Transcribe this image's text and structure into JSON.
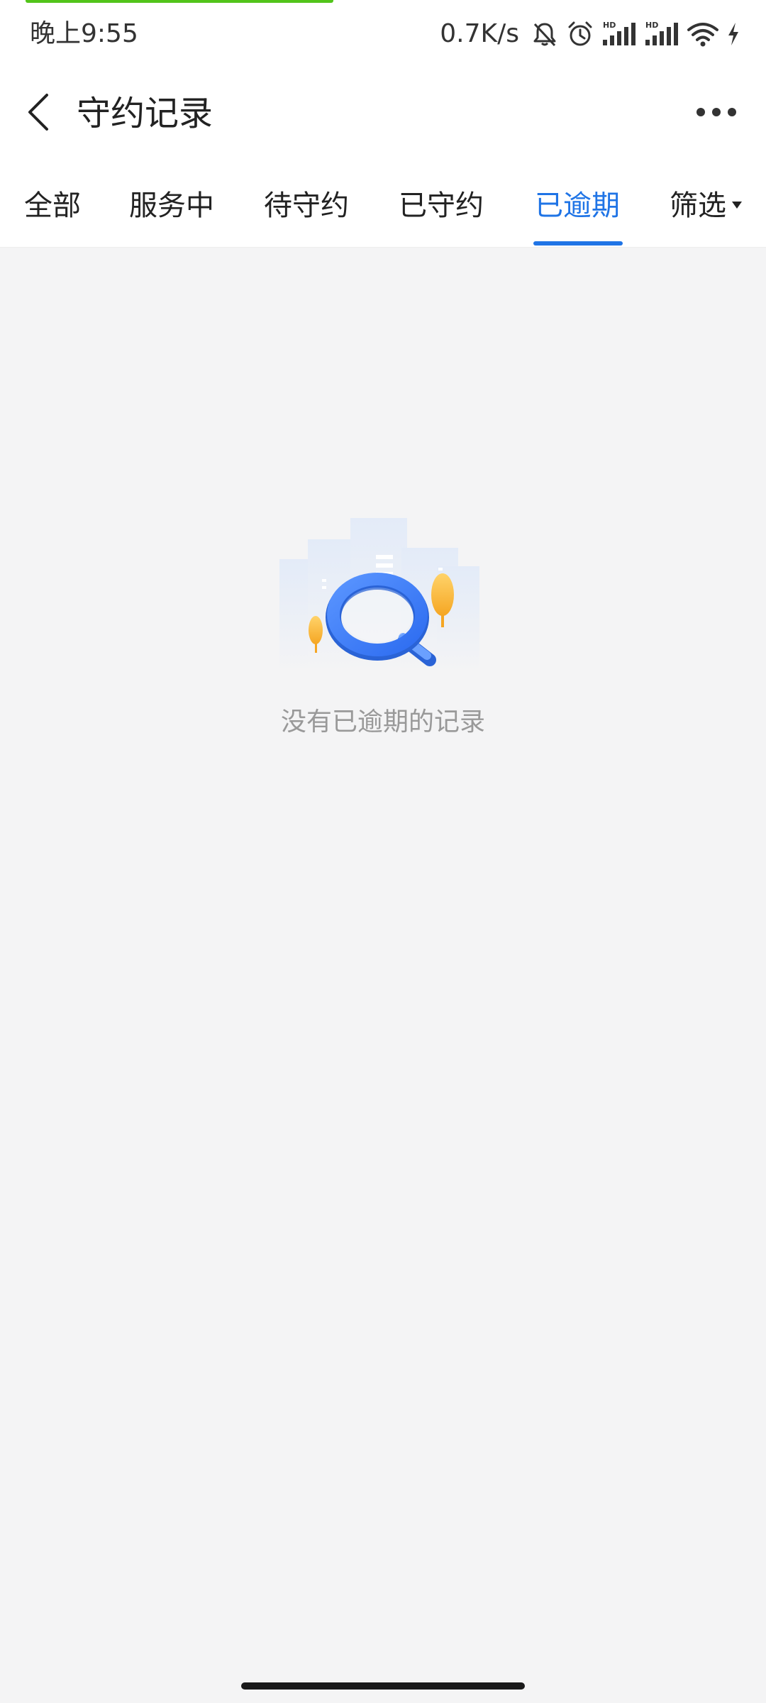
{
  "status_bar": {
    "time": "晚上9:55",
    "net_speed": "0.7K/s",
    "signal_label_1": "HD",
    "signal_label_2": "HD",
    "icons": [
      "bell-off-icon",
      "alarm-icon",
      "signal-hd-icon",
      "signal-hd-icon",
      "wifi-icon",
      "charging-icon"
    ]
  },
  "colors": {
    "accent": "#1f74e6",
    "load_bar": "#52c41a",
    "empty_text": "#999999",
    "background": "#f4f4f5"
  },
  "header": {
    "title": "守约记录",
    "back_icon": "chevron-left-icon",
    "more_icon": "more-horizontal-icon"
  },
  "tabs": [
    {
      "label": "全部",
      "active": false
    },
    {
      "label": "服务中",
      "active": false
    },
    {
      "label": "待守约",
      "active": false
    },
    {
      "label": "已守约",
      "active": false
    },
    {
      "label": "已逾期",
      "active": true
    }
  ],
  "filter": {
    "label": "筛选",
    "icon": "caret-down-icon"
  },
  "empty_state": {
    "icon": "magnifier-illustration",
    "message": "没有已逾期的记录"
  }
}
